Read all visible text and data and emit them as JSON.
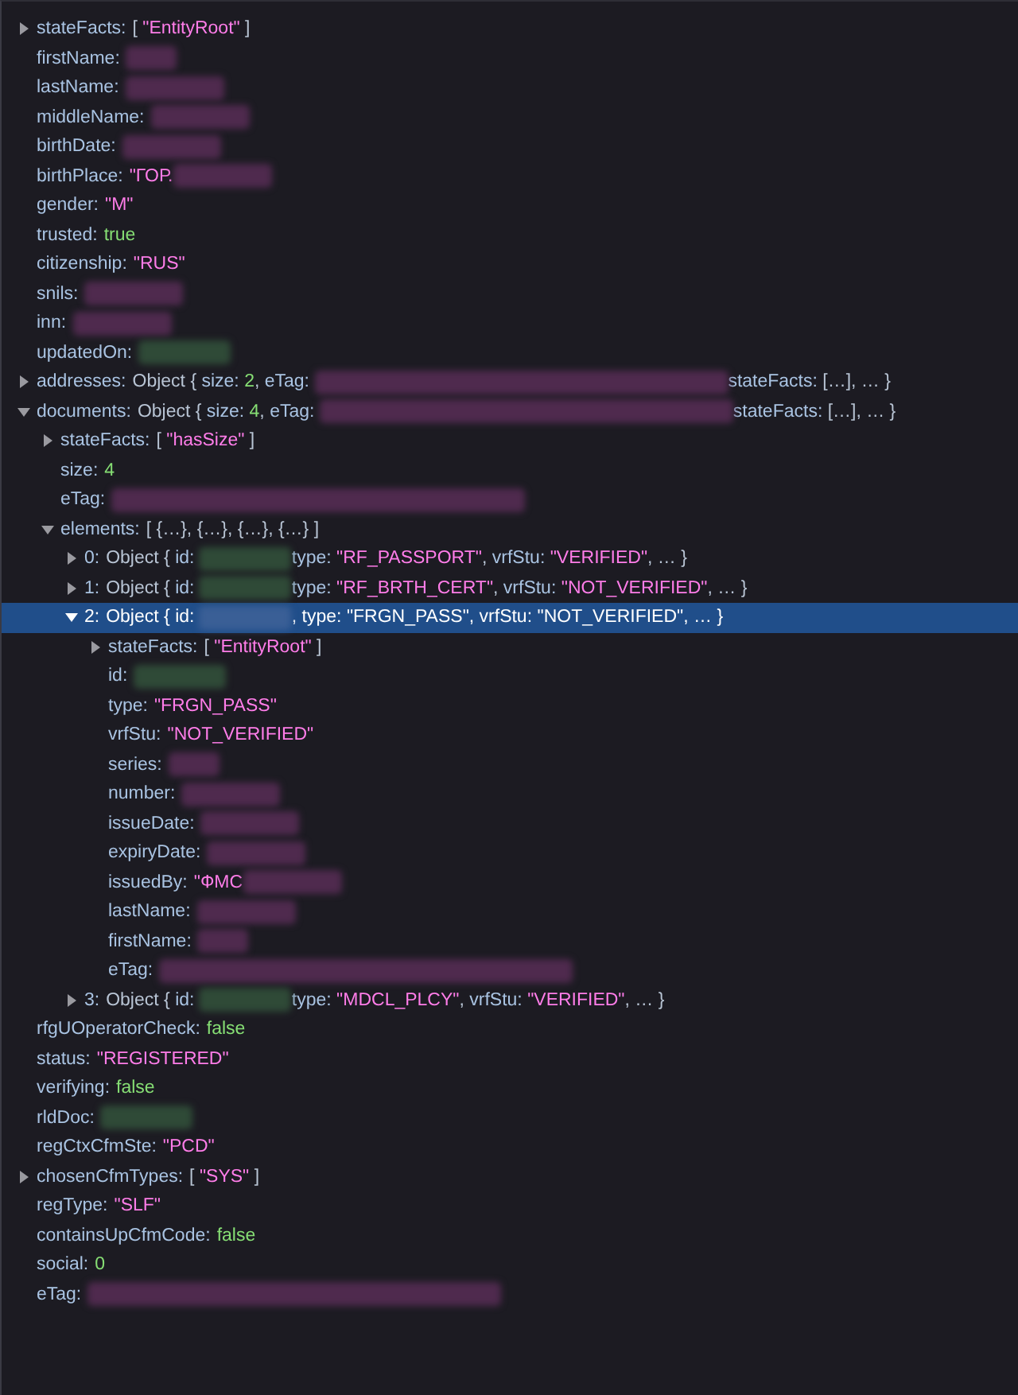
{
  "rows": [
    {
      "key": "stateFacts:",
      "expanded": false,
      "selected": false,
      "value": [
        {
          "kind": "punct",
          "text": "[ "
        },
        {
          "kind": "str",
          "text": "\"EntityRoot\""
        },
        {
          "kind": "punct",
          "text": " ]"
        }
      ]
    },
    {
      "key": "firstName:",
      "selected": false,
      "value": [
        {
          "kind": "redacted_short"
        }
      ]
    },
    {
      "key": "lastName:",
      "selected": false,
      "value": [
        {
          "kind": "redacted_text"
        }
      ]
    },
    {
      "key": "middleName:",
      "selected": false,
      "value": [
        {
          "kind": "redacted_text"
        }
      ]
    },
    {
      "key": "birthDate:",
      "selected": false,
      "value": [
        {
          "kind": "redacted_text"
        }
      ]
    },
    {
      "key": "birthPlace:",
      "selected": false,
      "value": [
        {
          "kind": "str",
          "text": "\"ГОР."
        },
        {
          "kind": "redacted_text"
        }
      ]
    },
    {
      "key": "gender:",
      "selected": false,
      "value": [
        {
          "kind": "str",
          "text": "\"M\""
        }
      ]
    },
    {
      "key": "trusted:",
      "selected": false,
      "value": [
        {
          "kind": "num",
          "text": "true"
        }
      ]
    },
    {
      "key": "citizenship:",
      "selected": false,
      "value": [
        {
          "kind": "str",
          "text": "\"RUS\""
        }
      ]
    },
    {
      "key": "snils:",
      "selected": false,
      "value": [
        {
          "kind": "redacted_text"
        }
      ]
    },
    {
      "key": "inn:",
      "selected": false,
      "value": [
        {
          "kind": "redacted_text"
        }
      ]
    },
    {
      "key": "updatedOn:",
      "selected": false,
      "value": [
        {
          "kind": "redacted_id"
        }
      ]
    },
    {
      "key": "addresses:",
      "expanded": false,
      "selected": false,
      "value": [
        {
          "kind": "punct",
          "text": "Object { "
        },
        {
          "kind": "key",
          "text": "size: "
        },
        {
          "kind": "num",
          "text": "2"
        },
        {
          "kind": "punct",
          "text": ", "
        },
        {
          "kind": "key",
          "text": "eTag: "
        },
        {
          "kind": "redacted_long"
        },
        {
          "kind": "key",
          "text": "stateFacts: "
        },
        {
          "kind": "punct",
          "text": "[…], … }"
        }
      ]
    },
    {
      "key": "documents:",
      "expanded": true,
      "selected": false,
      "value": [
        {
          "kind": "punct",
          "text": "Object { "
        },
        {
          "kind": "key",
          "text": "size: "
        },
        {
          "kind": "num",
          "text": "4"
        },
        {
          "kind": "punct",
          "text": ", "
        },
        {
          "kind": "key",
          "text": "eTag: "
        },
        {
          "kind": "redacted_long"
        },
        {
          "kind": "key",
          "text": "stateFacts: "
        },
        {
          "kind": "punct",
          "text": "[…], … }"
        }
      ],
      "children": [
        {
          "key": "stateFacts:",
          "expanded": false,
          "selected": false,
          "value": [
            {
              "kind": "punct",
              "text": "[ "
            },
            {
              "kind": "str",
              "text": "\"hasSize\""
            },
            {
              "kind": "punct",
              "text": " ]"
            }
          ]
        },
        {
          "key": "size:",
          "selected": false,
          "value": [
            {
              "kind": "num",
              "text": "4"
            }
          ]
        },
        {
          "key": "eTag:",
          "selected": false,
          "value": [
            {
              "kind": "redacted_long"
            }
          ]
        },
        {
          "key": "elements:",
          "expanded": true,
          "selected": false,
          "value": [
            {
              "kind": "punct",
              "text": "[ {…}, {…}, {…}, {…} ]"
            }
          ],
          "children": [
            {
              "key": "0:",
              "expanded": false,
              "selected": false,
              "value": [
                {
                  "kind": "punct",
                  "text": "Object { "
                },
                {
                  "kind": "key",
                  "text": "id: "
                },
                {
                  "kind": "redacted_id"
                },
                {
                  "kind": "key",
                  "text": "type: "
                },
                {
                  "kind": "str",
                  "text": "\"RF_PASSPORT\""
                },
                {
                  "kind": "punct",
                  "text": ", "
                },
                {
                  "kind": "key",
                  "text": "vrfStu: "
                },
                {
                  "kind": "str",
                  "text": "\"VERIFIED\""
                },
                {
                  "kind": "punct",
                  "text": ", … }"
                }
              ]
            },
            {
              "key": "1:",
              "expanded": false,
              "selected": false,
              "value": [
                {
                  "kind": "punct",
                  "text": "Object { "
                },
                {
                  "kind": "key",
                  "text": "id: "
                },
                {
                  "kind": "redacted_id"
                },
                {
                  "kind": "key",
                  "text": "type: "
                },
                {
                  "kind": "str",
                  "text": "\"RF_BRTH_CERT\""
                },
                {
                  "kind": "punct",
                  "text": ", "
                },
                {
                  "kind": "key",
                  "text": "vrfStu: "
                },
                {
                  "kind": "str",
                  "text": "\"NOT_VERIFIED\""
                },
                {
                  "kind": "punct",
                  "text": ", … }"
                }
              ]
            },
            {
              "key": "2:",
              "expanded": true,
              "selected": true,
              "value": [
                {
                  "kind": "punct",
                  "text": "Object { "
                },
                {
                  "kind": "key",
                  "text": "id: "
                },
                {
                  "kind": "redacted_id"
                },
                {
                  "kind": "punct",
                  "text": ", "
                },
                {
                  "kind": "key",
                  "text": "type: "
                },
                {
                  "kind": "str",
                  "text": "\"FRGN_PASS\""
                },
                {
                  "kind": "punct",
                  "text": ", "
                },
                {
                  "kind": "key",
                  "text": "vrfStu: "
                },
                {
                  "kind": "str",
                  "text": "\"NOT_VERIFIED\""
                },
                {
                  "kind": "punct",
                  "text": ", … }"
                }
              ],
              "children": [
                {
                  "key": "stateFacts:",
                  "expanded": false,
                  "selected": false,
                  "value": [
                    {
                      "kind": "punct",
                      "text": "[ "
                    },
                    {
                      "kind": "str",
                      "text": "\"EntityRoot\""
                    },
                    {
                      "kind": "punct",
                      "text": " ]"
                    }
                  ]
                },
                {
                  "key": "id:",
                  "selected": false,
                  "value": [
                    {
                      "kind": "redacted_id"
                    }
                  ]
                },
                {
                  "key": "type:",
                  "selected": false,
                  "value": [
                    {
                      "kind": "str",
                      "text": "\"FRGN_PASS\""
                    }
                  ]
                },
                {
                  "key": "vrfStu:",
                  "selected": false,
                  "value": [
                    {
                      "kind": "str",
                      "text": "\"NOT_VERIFIED\""
                    }
                  ]
                },
                {
                  "key": "series:",
                  "selected": false,
                  "value": [
                    {
                      "kind": "redacted_short"
                    }
                  ]
                },
                {
                  "key": "number:",
                  "selected": false,
                  "value": [
                    {
                      "kind": "redacted_text"
                    }
                  ]
                },
                {
                  "key": "issueDate:",
                  "selected": false,
                  "value": [
                    {
                      "kind": "redacted_text"
                    }
                  ]
                },
                {
                  "key": "expiryDate:",
                  "selected": false,
                  "value": [
                    {
                      "kind": "redacted_text"
                    }
                  ]
                },
                {
                  "key": "issuedBy:",
                  "selected": false,
                  "value": [
                    {
                      "kind": "str",
                      "text": "\"ФМС"
                    },
                    {
                      "kind": "redacted_text"
                    }
                  ]
                },
                {
                  "key": "lastName:",
                  "selected": false,
                  "value": [
                    {
                      "kind": "redacted_text"
                    }
                  ]
                },
                {
                  "key": "firstName:",
                  "selected": false,
                  "value": [
                    {
                      "kind": "redacted_short"
                    }
                  ]
                },
                {
                  "key": "eTag:",
                  "selected": false,
                  "value": [
                    {
                      "kind": "redacted_long"
                    }
                  ]
                }
              ]
            },
            {
              "key": "3:",
              "expanded": false,
              "selected": false,
              "value": [
                {
                  "kind": "punct",
                  "text": "Object { "
                },
                {
                  "kind": "key",
                  "text": "id: "
                },
                {
                  "kind": "redacted_id"
                },
                {
                  "kind": "key",
                  "text": "type: "
                },
                {
                  "kind": "str",
                  "text": "\"MDCL_PLCY\""
                },
                {
                  "kind": "punct",
                  "text": ", "
                },
                {
                  "kind": "key",
                  "text": "vrfStu: "
                },
                {
                  "kind": "str",
                  "text": "\"VERIFIED\""
                },
                {
                  "kind": "punct",
                  "text": ", … }"
                }
              ]
            }
          ]
        }
      ]
    },
    {
      "key": "rfgUOperatorCheck:",
      "selected": false,
      "value": [
        {
          "kind": "num",
          "text": "false"
        }
      ]
    },
    {
      "key": "status:",
      "selected": false,
      "value": [
        {
          "kind": "str",
          "text": "\"REGISTERED\""
        }
      ]
    },
    {
      "key": "verifying:",
      "selected": false,
      "value": [
        {
          "kind": "num",
          "text": "false"
        }
      ]
    },
    {
      "key": "rldDoc:",
      "selected": false,
      "value": [
        {
          "kind": "redacted_id"
        }
      ]
    },
    {
      "key": "regCtxCfmSte:",
      "selected": false,
      "value": [
        {
          "kind": "str",
          "text": "\"PCD\""
        }
      ]
    },
    {
      "key": "chosenCfmTypes:",
      "expanded": false,
      "selected": false,
      "value": [
        {
          "kind": "punct",
          "text": "[ "
        },
        {
          "kind": "str",
          "text": "\"SYS\""
        },
        {
          "kind": "punct",
          "text": " ]"
        }
      ]
    },
    {
      "key": "regType:",
      "selected": false,
      "value": [
        {
          "kind": "str",
          "text": "\"SLF\""
        }
      ]
    },
    {
      "key": "containsUpCfmCode:",
      "selected": false,
      "value": [
        {
          "kind": "num",
          "text": "false"
        }
      ]
    },
    {
      "key": "social:",
      "selected": false,
      "value": [
        {
          "kind": "num",
          "text": "0"
        }
      ]
    },
    {
      "key": "eTag:",
      "selected": false,
      "value": [
        {
          "kind": "redacted_long"
        }
      ]
    }
  ]
}
